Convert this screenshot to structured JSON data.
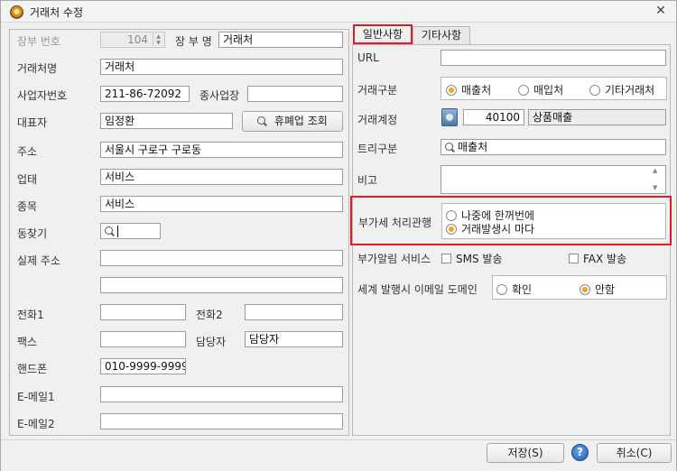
{
  "window": {
    "title": "거래처 수정",
    "close": "✕"
  },
  "left": {
    "ledger_no_label": "장부 번호",
    "ledger_no_value": "104",
    "ledger_name_label": "장 부 명",
    "ledger_name_value": "거래처",
    "client_name_label": "거래처명",
    "client_name_value": "거래처",
    "biz_no_label": "사업자번호",
    "biz_no_value": "211-86-72092",
    "branch_label": "종사업장",
    "branch_value": "",
    "rep_label": "대표자",
    "rep_value": "임정환",
    "closure_btn": "휴폐업 조회",
    "address_label": "주소",
    "address_value": "서울시 구로구 구로동",
    "biz_type_label": "업태",
    "biz_type_value": "서비스",
    "biz_item_label": "종목",
    "biz_item_value": "서비스",
    "dong_label": "동찾기",
    "dong_value": "",
    "real_addr_label": "실제 주소",
    "real_addr_value1": "",
    "real_addr_value2": "",
    "phone1_label": "전화1",
    "phone1_value": "",
    "phone2_label": "전화2",
    "phone2_value": "",
    "fax_label": "팩스",
    "fax_value": "",
    "manager_label": "담당자",
    "manager_value": "담당자",
    "mobile_label": "핸드폰",
    "mobile_value": "010-9999-9999",
    "email1_label": "E-메일1",
    "email1_value": "",
    "email2_label": "E-메일2",
    "email2_value": ""
  },
  "tabs": [
    {
      "label": "일반사항",
      "active": true
    },
    {
      "label": "기타사항",
      "active": false
    }
  ],
  "general": {
    "url_label": "URL",
    "url_value": "",
    "type_label": "거래구분",
    "type_options": [
      {
        "label": "매출처",
        "checked": true
      },
      {
        "label": "매입처",
        "checked": false
      },
      {
        "label": "기타거래처",
        "checked": false
      }
    ],
    "account_label": "거래계정",
    "account_code": "40100",
    "account_name": "상품매출",
    "tree_label": "트리구분",
    "tree_value": "매출처",
    "note_label": "비고",
    "note_value": "",
    "vat_label": "부가세 처리관행",
    "vat_options": [
      {
        "label": "나중에 한꺼번에",
        "checked": false
      },
      {
        "label": "거래발생시 마다",
        "checked": true
      }
    ],
    "notify_label": "부가알림 서비스",
    "sms_label": "SMS 발송",
    "fax_label": "FAX 발송",
    "email_domain_label": "세계 발행시 이메일 도메인",
    "email_domain_options": [
      {
        "label": "확인",
        "checked": false
      },
      {
        "label": "안함",
        "checked": true
      }
    ]
  },
  "buttons": {
    "save": "저장(S)",
    "help": "?",
    "cancel": "취소(C)"
  },
  "colors": {
    "highlight": "#e01b24",
    "radio_selected": "#f4a51c"
  }
}
